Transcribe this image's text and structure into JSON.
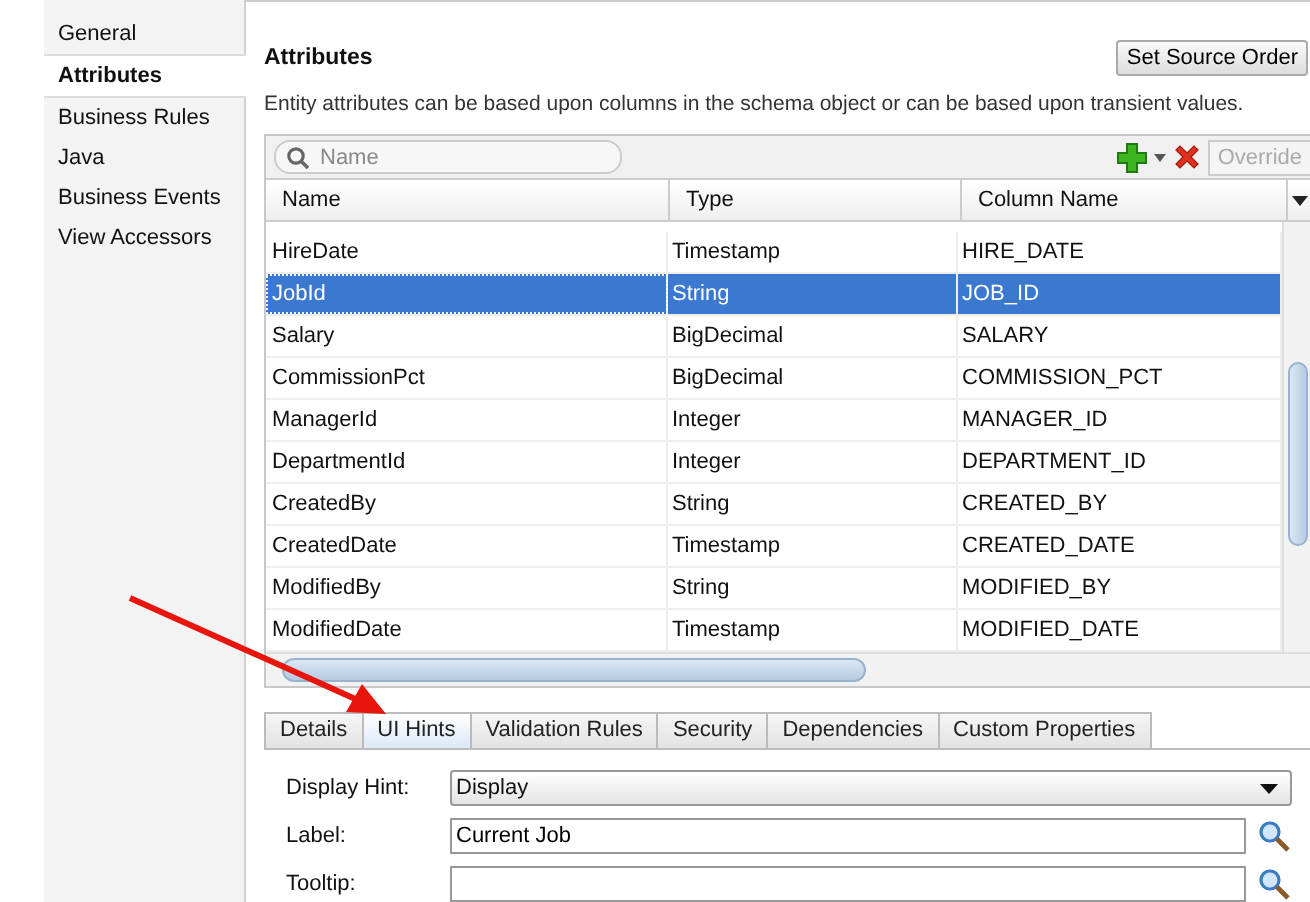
{
  "sidebar": {
    "items": [
      {
        "label": "General",
        "selected": false
      },
      {
        "label": "Attributes",
        "selected": true
      },
      {
        "label": "Business Rules",
        "selected": false
      },
      {
        "label": "Java",
        "selected": false
      },
      {
        "label": "Business Events",
        "selected": false
      },
      {
        "label": "View Accessors",
        "selected": false
      }
    ]
  },
  "panel": {
    "title": "Attributes",
    "set_source_order_button": "Set Source Order",
    "description": "Entity attributes can be based upon columns in the schema object or can be based upon transient values."
  },
  "toolbar": {
    "search": {
      "placeholder": "Name"
    },
    "override_button": {
      "label": "Override",
      "disabled": true
    }
  },
  "table": {
    "columns": [
      "Name",
      "Type",
      "Column Name"
    ],
    "rows": [
      {
        "cells": [
          "HireDate",
          "Timestamp",
          "HIRE_DATE"
        ],
        "selected": false
      },
      {
        "cells": [
          "JobId",
          "String",
          "JOB_ID"
        ],
        "selected": true
      },
      {
        "cells": [
          "Salary",
          "BigDecimal",
          "SALARY"
        ],
        "selected": false
      },
      {
        "cells": [
          "CommissionPct",
          "BigDecimal",
          "COMMISSION_PCT"
        ],
        "selected": false
      },
      {
        "cells": [
          "ManagerId",
          "Integer",
          "MANAGER_ID"
        ],
        "selected": false
      },
      {
        "cells": [
          "DepartmentId",
          "Integer",
          "DEPARTMENT_ID"
        ],
        "selected": false
      },
      {
        "cells": [
          "CreatedBy",
          "String",
          "CREATED_BY"
        ],
        "selected": false
      },
      {
        "cells": [
          "CreatedDate",
          "Timestamp",
          "CREATED_DATE"
        ],
        "selected": false
      },
      {
        "cells": [
          "ModifiedBy",
          "String",
          "MODIFIED_BY"
        ],
        "selected": false
      },
      {
        "cells": [
          "ModifiedDate",
          "Timestamp",
          "MODIFIED_DATE"
        ],
        "selected": false
      }
    ]
  },
  "detail_tabs": [
    {
      "label": "Details",
      "selected": false
    },
    {
      "label": "UI Hints",
      "selected": true
    },
    {
      "label": "Validation Rules",
      "selected": false
    },
    {
      "label": "Security",
      "selected": false
    },
    {
      "label": "Dependencies",
      "selected": false
    },
    {
      "label": "Custom Properties",
      "selected": false
    }
  ],
  "form": [
    {
      "kind": "dropdown",
      "label": "Display Hint:",
      "value": "Display"
    },
    {
      "kind": "text",
      "label": "Label:",
      "value": "Current Job"
    },
    {
      "kind": "text",
      "label": "Tooltip:"
    }
  ]
}
